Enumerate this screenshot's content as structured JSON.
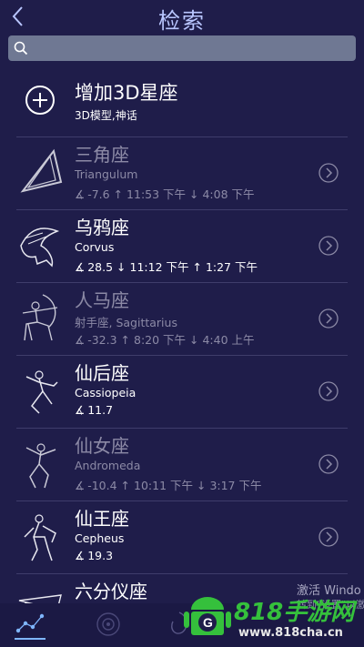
{
  "header": {
    "title": "检索"
  },
  "search": {
    "placeholder": "",
    "value": ""
  },
  "add_item": {
    "title": "增加3D星座",
    "subtitle": "3D模型,神话"
  },
  "constellations": [
    {
      "name": "三角座",
      "latin": "Triangulum",
      "alt": "-7.6",
      "rise": "11:53 下午",
      "set": "4:08 下午",
      "dim": true
    },
    {
      "name": "乌鸦座",
      "latin": "Corvus",
      "alt": "28.5",
      "set": "11:12 下午",
      "rise": "1:27 下午",
      "dim": false
    },
    {
      "name": "人马座",
      "latin": "射手座, Sagittarius",
      "alt": "-32.3",
      "rise": "8:20 下午",
      "set": "4:40 上午",
      "dim": true
    },
    {
      "name": "仙后座",
      "latin": "Cassiopeia",
      "alt": "11.7",
      "dim": false
    },
    {
      "name": "仙女座",
      "latin": "Andromeda",
      "alt": "-10.4",
      "rise": "10:11 下午",
      "set": "3:17 下午",
      "dim": true
    },
    {
      "name": "仙王座",
      "latin": "Cepheus",
      "alt": "19.3",
      "dim": false
    },
    {
      "name": "六分仪座",
      "dim": false
    }
  ],
  "watermark": {
    "line1": "激活 Windo",
    "line2": "转到\"设置\"以激"
  },
  "site_logo": {
    "text": "818手游网",
    "url": "www.818cha.cn"
  },
  "colors": {
    "background": "#1f1d4a",
    "title": "#b9c6ff",
    "search_bg": "#6f7893",
    "tab_active": "#7fb6ff",
    "logo_green": "#35c03c"
  }
}
